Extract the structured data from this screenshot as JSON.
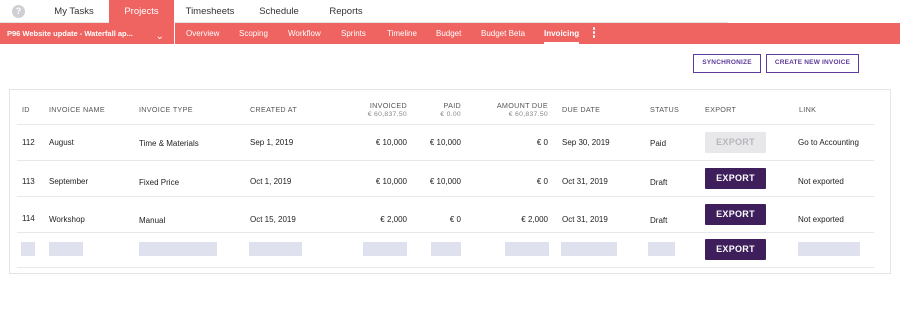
{
  "topnav": {
    "logo": "?",
    "tabs": [
      {
        "label": "My Tasks"
      },
      {
        "label": "Projects"
      },
      {
        "label": "Timesheets"
      },
      {
        "label": "Schedule"
      },
      {
        "label": "Reports"
      }
    ]
  },
  "project": {
    "selector": "P96  Website update - Waterfall ap...",
    "tabs": [
      {
        "label": "Overview"
      },
      {
        "label": "Scoping"
      },
      {
        "label": "Workflow"
      },
      {
        "label": "Sprints"
      },
      {
        "label": "Timeline"
      },
      {
        "label": "Budget"
      },
      {
        "label": "Budget Beta"
      },
      {
        "label": "Invoicing"
      }
    ]
  },
  "actions": {
    "synchronize": "SYNCHRONIZE",
    "create": "CREATE NEW INVOICE"
  },
  "table": {
    "headers": {
      "id": "ID",
      "name": "INVOICE NAME",
      "type": "INVOICE TYPE",
      "created": "CREATED AT",
      "invoiced": "INVOICED",
      "invoiced_total": "€ 60,837.50",
      "paid": "PAID",
      "paid_total": "€ 0.00",
      "amount_due": "AMOUNT DUE",
      "amount_due_total": "€ 60,837.50",
      "due_date": "DUE DATE",
      "status": "STATUS",
      "export": "EXPORT",
      "link": "LINK"
    },
    "rows": [
      {
        "id": "112",
        "name": "August",
        "type": "Time & Materials",
        "created": "Sep 1, 2019",
        "invoiced": "€ 10,000",
        "paid": "€ 10,000",
        "amount_due": "€ 0",
        "due_date": "Sep 30, 2019",
        "status": "Paid",
        "export": "EXPORT",
        "link": "Go to Accounting"
      },
      {
        "id": "113",
        "name": "September",
        "type": "Fixed Price",
        "created": "Oct 1, 2019",
        "invoiced": "€ 10,000",
        "paid": "€ 10,000",
        "amount_due": "€ 0",
        "due_date": "Oct 31, 2019",
        "status": "Draft",
        "export": "EXPORT",
        "link": "Not exported"
      },
      {
        "id": "114",
        "name": "Workshop",
        "type": "Manual",
        "created": "Oct 15, 2019",
        "invoiced": "€ 2,000",
        "paid": "€ 0",
        "amount_due": "€ 2,000",
        "due_date": "Oct 31, 2019",
        "status": "Draft",
        "export": "EXPORT",
        "link": "Not exported"
      }
    ],
    "placeholder_row": {
      "export": "EXPORT"
    }
  }
}
